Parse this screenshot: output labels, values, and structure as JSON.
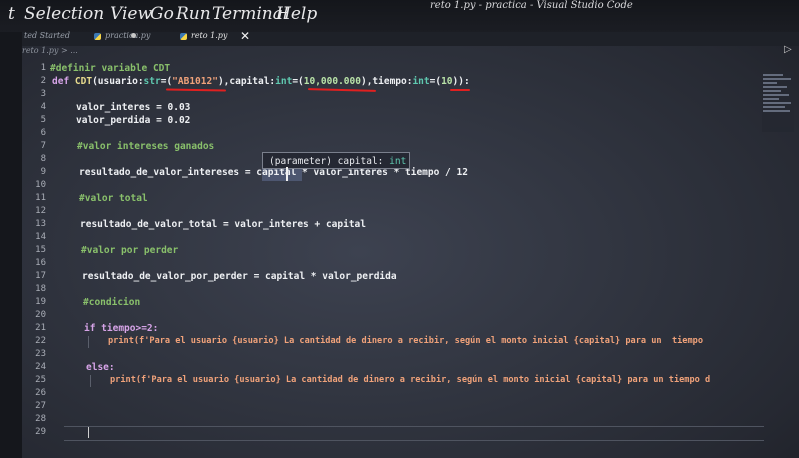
{
  "window": {
    "title": "reto 1.py - practica - Visual Studio Code"
  },
  "menu": [
    "t",
    "Selection",
    "View",
    "Go",
    "Run",
    "Terminal",
    "Help"
  ],
  "tabs": [
    {
      "label": "ted Started"
    },
    {
      "label": "practica.py"
    },
    {
      "label": "reto 1.py"
    }
  ],
  "breadcrumb": "reto 1.py > ...",
  "tooltip": {
    "param": "(parameter) capital:",
    "type": "int"
  },
  "lines": [
    {
      "n": "1",
      "code": "#definir variable CDT"
    },
    {
      "n": "2",
      "kw": "def ",
      "fn": "CDT",
      "a": "(usuario:",
      "ty1": "str",
      "b": "=(",
      "s1": "\"AB1012\"",
      "c": "),capital:",
      "ty2": "int",
      "d": "=(",
      "n1": "10,000.000",
      "e": "),tiempo:",
      "ty3": "int",
      "f": "=(",
      "n2": "10",
      "g": ")):"
    },
    {
      "n": "3"
    },
    {
      "n": "4",
      "code": "valor_interes = 0.03"
    },
    {
      "n": "5",
      "code": "valor_perdida = 0.02"
    },
    {
      "n": "6"
    },
    {
      "n": "7",
      "code": "#valor intereses ganados"
    },
    {
      "n": "8"
    },
    {
      "n": "9",
      "code": "resultado_de_valor_intereses = capital * valor_interes * tiempo / 12"
    },
    {
      "n": "10"
    },
    {
      "n": "11",
      "code": "#valor total"
    },
    {
      "n": "12"
    },
    {
      "n": "13",
      "code": "resultado_de_valor_total = valor_interes + capital"
    },
    {
      "n": "14"
    },
    {
      "n": "15",
      "code": "#valor por perder"
    },
    {
      "n": "16"
    },
    {
      "n": "17",
      "code": "resultado_de_valor_por_perder = capital * valor_perdida"
    },
    {
      "n": "18"
    },
    {
      "n": "19",
      "code": "#condicion"
    },
    {
      "n": "20"
    },
    {
      "n": "21",
      "code": "if tiempo>=2:"
    },
    {
      "n": "22",
      "code": "print(f'Para el usuario {usuario} La cantidad de dinero a recibir, según el monto inicial {capital} para un  tiempo"
    },
    {
      "n": "23"
    },
    {
      "n": "24",
      "code": "else:"
    },
    {
      "n": "25",
      "code": "print(f'Para el usuario {usuario} La cantidad de dinero a recibir, según el monto inicial {capital} para un tiempo d"
    },
    {
      "n": "26"
    },
    {
      "n": "27"
    },
    {
      "n": "28"
    },
    {
      "n": "29"
    }
  ],
  "colors": {
    "comment": "#89c06b",
    "keyword": "#d7a4e8",
    "string": "#f0a27a",
    "number": "#b9e3a8",
    "underline": "#e02020"
  }
}
